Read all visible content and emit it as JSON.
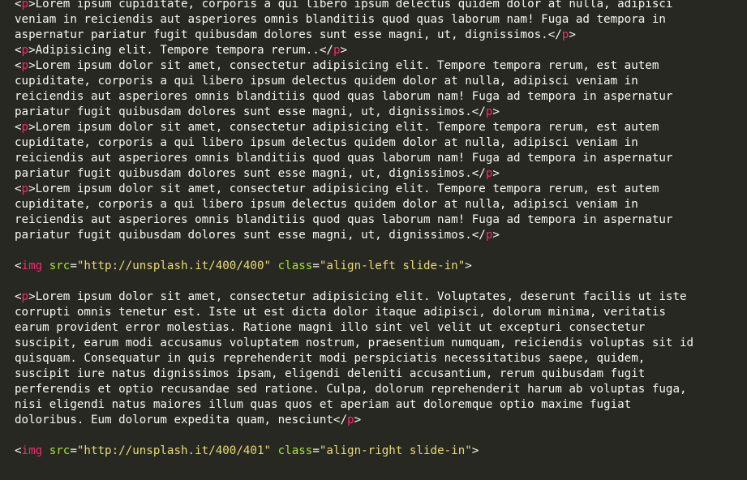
{
  "editor": {
    "theme_colors": {
      "background": "#272822",
      "text": "#f8f8f2",
      "tag": "#f92672",
      "attribute": "#a6e22e",
      "string": "#e6db74"
    },
    "lines": [
      {
        "open": "<",
        "tag": "p",
        "close": ">",
        "text": "Lorem ipsum cupiditate, corporis a qui libero ipsum delectus quidem dolor at nulla, adipisci"
      },
      {
        "text": "veniam in reiciendis aut asperiores omnis blanditiis quod quas laborum nam! Fuga ad tempora in"
      },
      {
        "text": "aspernatur pariatur fugit quibusdam dolores sunt esse magni, ut, dignissimos.",
        "end_open": "</",
        "end_tag": "p",
        "end_close": ">"
      },
      {
        "open": "<",
        "tag": "p",
        "close": ">",
        "text": "Adipisicing elit. Tempore tempora rerum..",
        "end_open": "</",
        "end_tag": "p",
        "end_close": ">"
      },
      {
        "open": "<",
        "tag": "p",
        "close": ">",
        "text": "Lorem ipsum dolor sit amet, consectetur adipisicing elit. Tempore tempora rerum, est autem"
      },
      {
        "text": "cupiditate, corporis a qui libero ipsum delectus quidem dolor at nulla, adipisci veniam in"
      },
      {
        "text": "reiciendis aut asperiores omnis blanditiis quod quas laborum nam! Fuga ad tempora in aspernatur"
      },
      {
        "text": "pariatur fugit quibusdam dolores sunt esse magni, ut, dignissimos.",
        "end_open": "</",
        "end_tag": "p",
        "end_close": ">"
      },
      {
        "open": "<",
        "tag": "p",
        "close": ">",
        "text": "Lorem ipsum dolor sit amet, consectetur adipisicing elit. Tempore tempora rerum, est autem"
      },
      {
        "text": "cupiditate, corporis a qui libero ipsum delectus quidem dolor at nulla, adipisci veniam in"
      },
      {
        "text": "reiciendis aut asperiores omnis blanditiis quod quas laborum nam! Fuga ad tempora in aspernatur"
      },
      {
        "text": "pariatur fugit quibusdam dolores sunt esse magni, ut, dignissimos.",
        "end_open": "</",
        "end_tag": "p",
        "end_close": ">"
      },
      {
        "open": "<",
        "tag": "p",
        "close": ">",
        "text": "Lorem ipsum dolor sit amet, consectetur adipisicing elit. Tempore tempora rerum, est autem"
      },
      {
        "text": "cupiditate, corporis a qui libero ipsum delectus quidem dolor at nulla, adipisci veniam in"
      },
      {
        "text": "reiciendis aut asperiores omnis blanditiis quod quas laborum nam! Fuga ad tempora in aspernatur"
      },
      {
        "text": "pariatur fugit quibusdam dolores sunt esse magni, ut, dignissimos.",
        "end_open": "</",
        "end_tag": "p",
        "end_close": ">"
      },
      {
        "text": ""
      },
      {
        "open": "<",
        "tag": "img",
        "attrs": [
          {
            "name": "src",
            "eq": "=",
            "value": "\"http://unsplash.it/400/400\""
          },
          {
            "name": "class",
            "eq": "=",
            "value": "\"align-left slide-in\""
          }
        ],
        "close": ">"
      },
      {
        "text": ""
      },
      {
        "open": "<",
        "tag": "p",
        "close": ">",
        "text": "Lorem ipsum dolor sit amet, consectetur adipisicing elit. Voluptates, deserunt facilis ut iste"
      },
      {
        "text": "corrupti omnis tenetur est. Iste ut est dicta dolor itaque adipisci, dolorum minima, veritatis"
      },
      {
        "text": "earum provident error molestias. Ratione magni illo sint vel velit ut excepturi consectetur"
      },
      {
        "text": "suscipit, earum modi accusamus voluptatem nostrum, praesentium numquam, reiciendis voluptas sit id"
      },
      {
        "text": "quisquam. Consequatur in quis reprehenderit modi perspiciatis necessitatibus saepe, quidem,"
      },
      {
        "text": "suscipit iure natus dignissimos ipsam, eligendi deleniti accusantium, rerum quibusdam fugit"
      },
      {
        "text": "perferendis et optio recusandae sed ratione. Culpa, dolorum reprehenderit harum ab voluptas fuga,"
      },
      {
        "text": "nisi eligendi natus maiores illum quas quos et aperiam aut doloremque optio maxime fugiat"
      },
      {
        "text": "doloribus. Eum dolorum expedita quam, nesciunt",
        "end_open": "</",
        "end_tag": "p",
        "end_close": ">"
      },
      {
        "text": ""
      },
      {
        "open": "<",
        "tag": "img",
        "attrs": [
          {
            "name": "src",
            "eq": "=",
            "value": "\"http://unsplash.it/400/401\""
          },
          {
            "name": "class",
            "eq": "=",
            "value": "\"align-right slide-in\""
          }
        ],
        "close": ">"
      }
    ]
  }
}
